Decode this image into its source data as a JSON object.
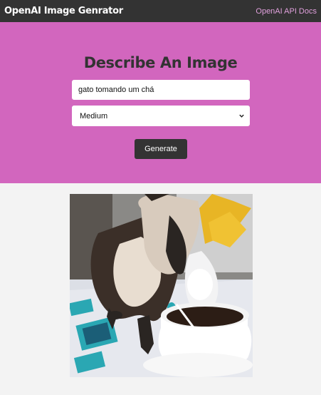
{
  "navbar": {
    "logo": "OpenAI Image Genrator",
    "docs_link": "OpenAI API Docs"
  },
  "hero": {
    "title": "Describe An Image",
    "prompt_value": "gato tomando um chá",
    "size_selected": "Medium",
    "generate_label": "Generate"
  },
  "colors": {
    "navbar_bg": "#333333",
    "hero_bg": "#d266be",
    "link": "#e0a0dc",
    "page_bg": "#f3f3f3"
  },
  "icons": {
    "select_arrow": "chevron-down-icon"
  }
}
